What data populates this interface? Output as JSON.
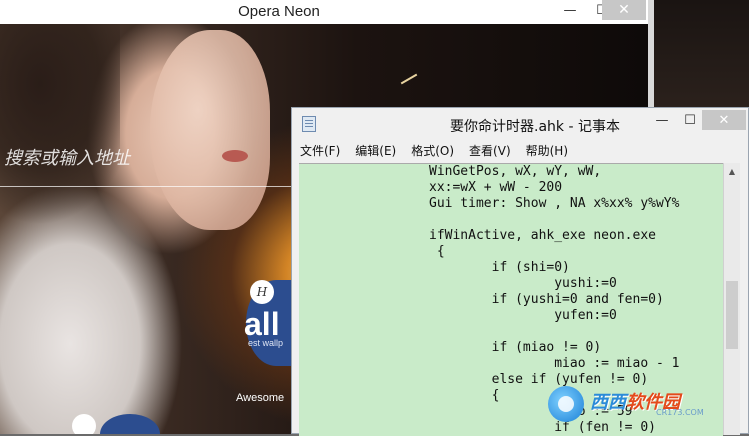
{
  "opera": {
    "title": "Opera Neon",
    "min": "—",
    "max": "☐",
    "close": "✕",
    "search_placeholder": "搜索或输入地址",
    "dial_label": "all",
    "dial_sub": "est wallp",
    "dial_icon": "H",
    "awesome": "Awesome"
  },
  "notepad": {
    "title": "要你命计时器.ahk - 记事本",
    "min": "—",
    "max": "☐",
    "close": "✕",
    "menu": [
      "文件(F)",
      "编辑(E)",
      "格式(O)",
      "查看(V)",
      "帮助(H)"
    ],
    "lines": [
      "WinGetPos, wX, wY, wW,",
      "xx:=wX + wW - 200",
      "Gui timer: Show , NA x%xx% y%wY%",
      "",
      "ifWinActive, ahk_exe neon.exe",
      " {",
      "        if (shi=0)",
      "                yushi:=0",
      "        if (yushi=0 and fen=0)",
      "                yufen:=0",
      "",
      "        if (miao != 0)",
      "                miao := miao - 1",
      "        else if (yufen != 0)",
      "        {",
      "                miao := 59",
      "                if (fen != 0)"
    ]
  },
  "watermark": {
    "name": "西西",
    "brand": "软件园",
    "url": "CR173.COM"
  },
  "colors": {
    "editor_bg": "#c9ebc9",
    "dial_blue": "#2c4d8f",
    "close_gray": "#c7c7c7"
  },
  "icons": [
    "notepad-icon",
    "minimize-icon",
    "maximize-icon",
    "close-icon",
    "scroll-up-arrow-icon",
    "speed-dial-icon",
    "watermark-logo-icon"
  ]
}
